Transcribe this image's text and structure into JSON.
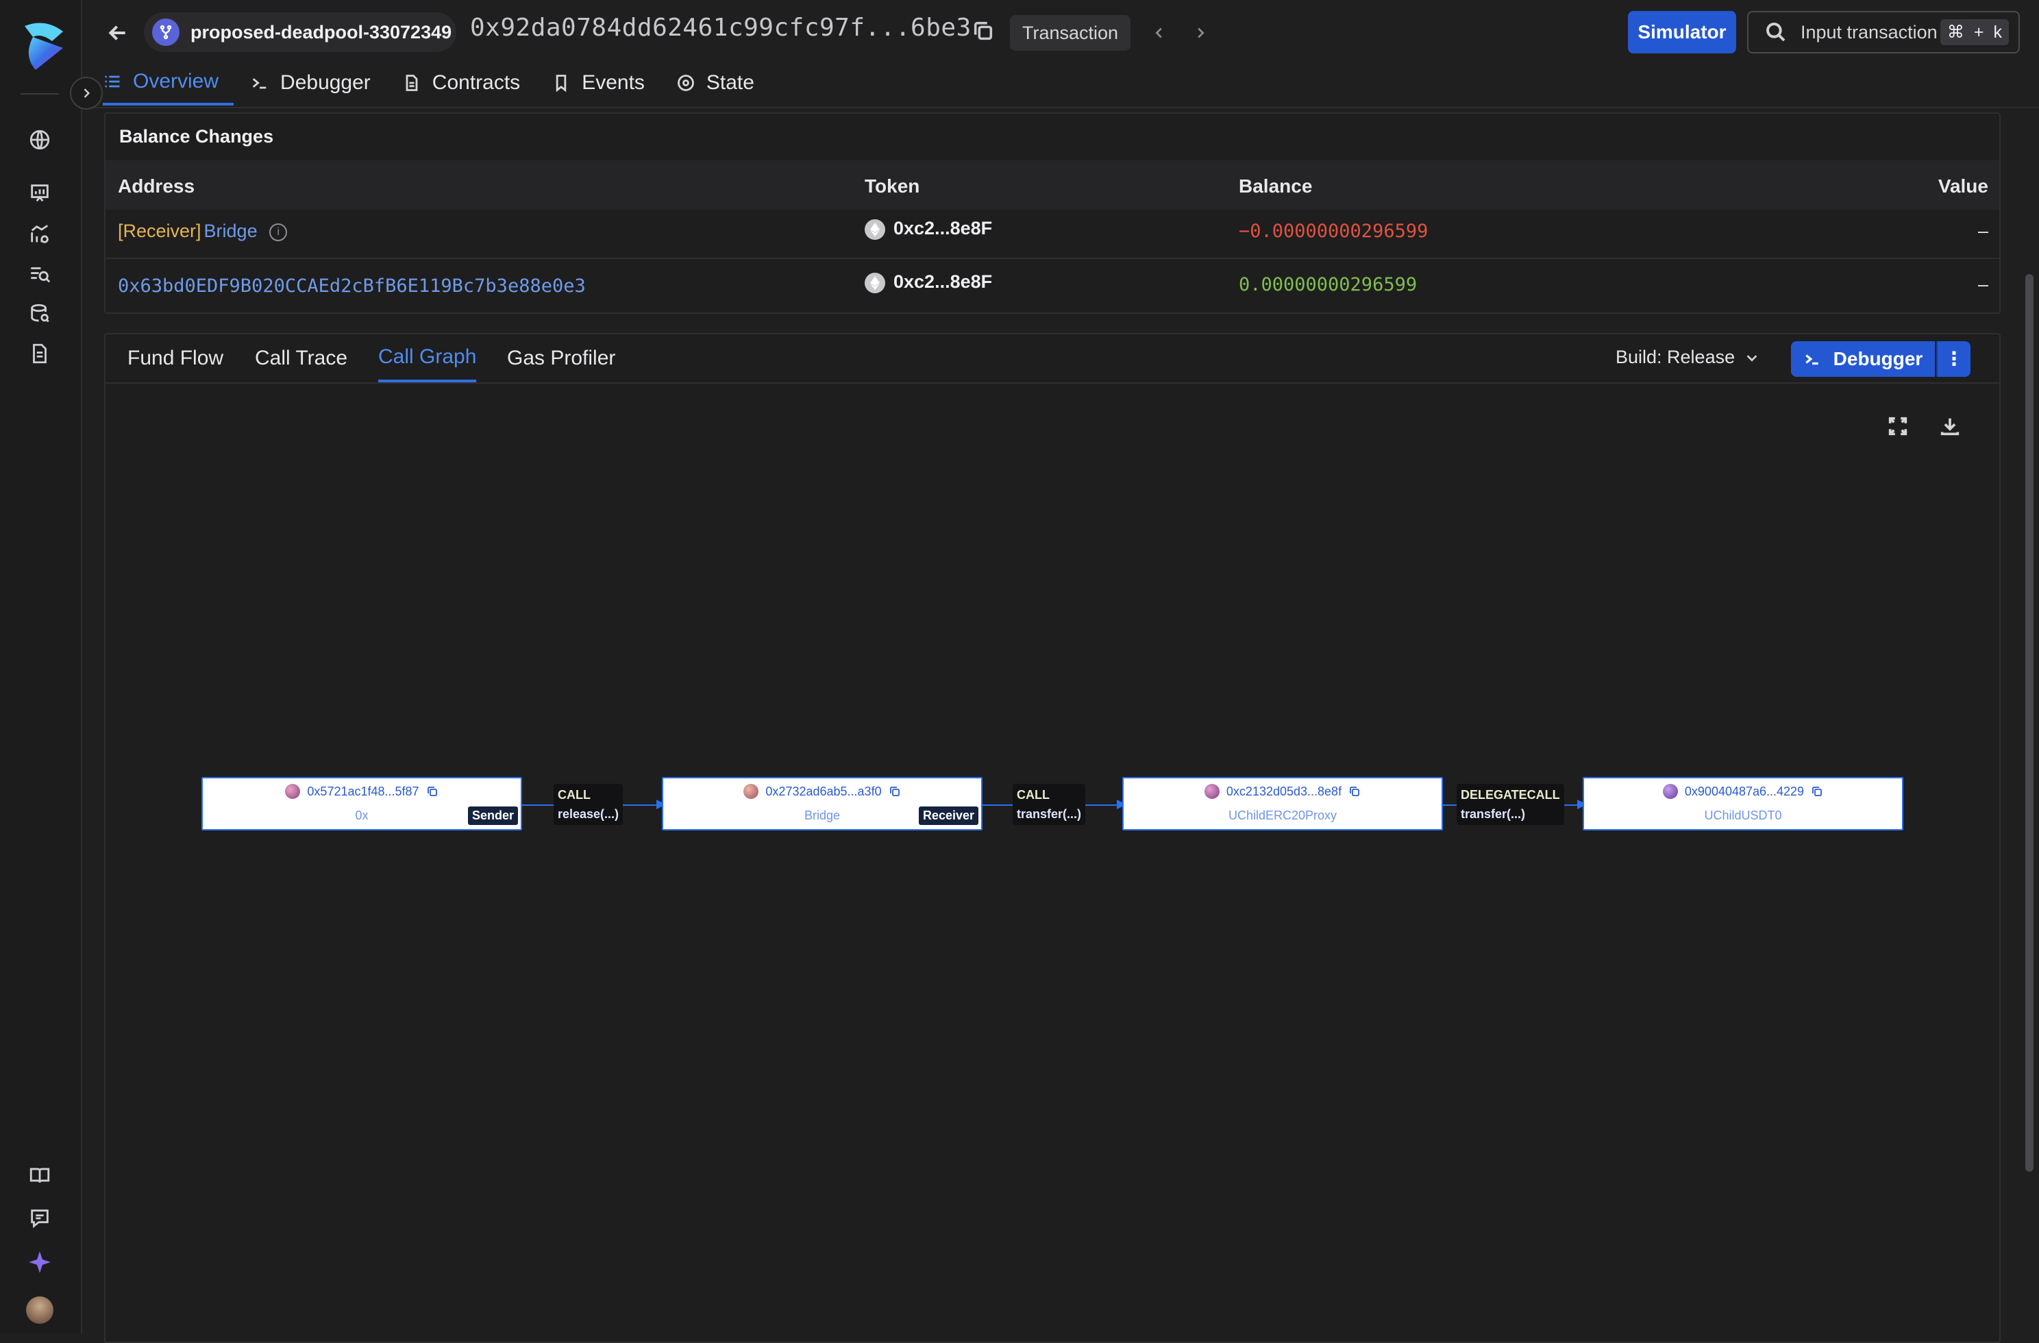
{
  "header": {
    "project_name": "proposed-deadpool-33072349",
    "tx_hash": "0x92da0784dd62461c99cfc97f...6be3",
    "type_badge": "Transaction",
    "simulator_label": "Simulator",
    "search_placeholder": "Input transaction hash",
    "shortcut_cmd": "⌘",
    "shortcut_plus": "+",
    "shortcut_key": "k"
  },
  "tabs": [
    "Overview",
    "Debugger",
    "Contracts",
    "Events",
    "State"
  ],
  "balance_changes": {
    "title": "Balance Changes",
    "columns": [
      "Address",
      "Token",
      "Balance",
      "Value"
    ],
    "rows": [
      {
        "role": "[Receiver]",
        "address": "Bridge",
        "token": "0xc2...8e8F",
        "balance": "−0.00000000296599",
        "value": "–"
      },
      {
        "role": "",
        "address": "0x63bd0EDF9B020CCAEd2cBfB6E119Bc7b3e88e0e3",
        "token": "0xc2...8e8F",
        "balance": "0.00000000296599",
        "value": "–"
      }
    ]
  },
  "graph_panel": {
    "tabs": [
      "Fund Flow",
      "Call Trace",
      "Call Graph",
      "Gas Profiler"
    ],
    "active_tab": "Call Graph",
    "build_label": "Build: Release",
    "debugger_label": "Debugger"
  },
  "call_graph": {
    "nodes": [
      {
        "address": "0x5721ac1f48...5f87",
        "name": "0x",
        "tag": "Sender"
      },
      {
        "address": "0x2732ad6ab5...a3f0",
        "name": "Bridge",
        "tag": "Receiver"
      },
      {
        "address": "0xc2132d05d3...8e8f",
        "name": "UChildERC20Proxy",
        "tag": ""
      },
      {
        "address": "0x90040487a6...4229",
        "name": "UChildUSDT0",
        "tag": ""
      }
    ],
    "edges": [
      {
        "kind": "CALL",
        "fn": "release(...)"
      },
      {
        "kind": "CALL",
        "fn": "transfer(...)"
      },
      {
        "kind": "DELEGATECALL",
        "fn": "transfer(...)"
      }
    ]
  },
  "colors": {
    "accent": "#2458d2",
    "link": "#6f9be8",
    "negative": "#e0523f",
    "positive": "#7fbf4d",
    "receiver_role": "#e6b450"
  }
}
